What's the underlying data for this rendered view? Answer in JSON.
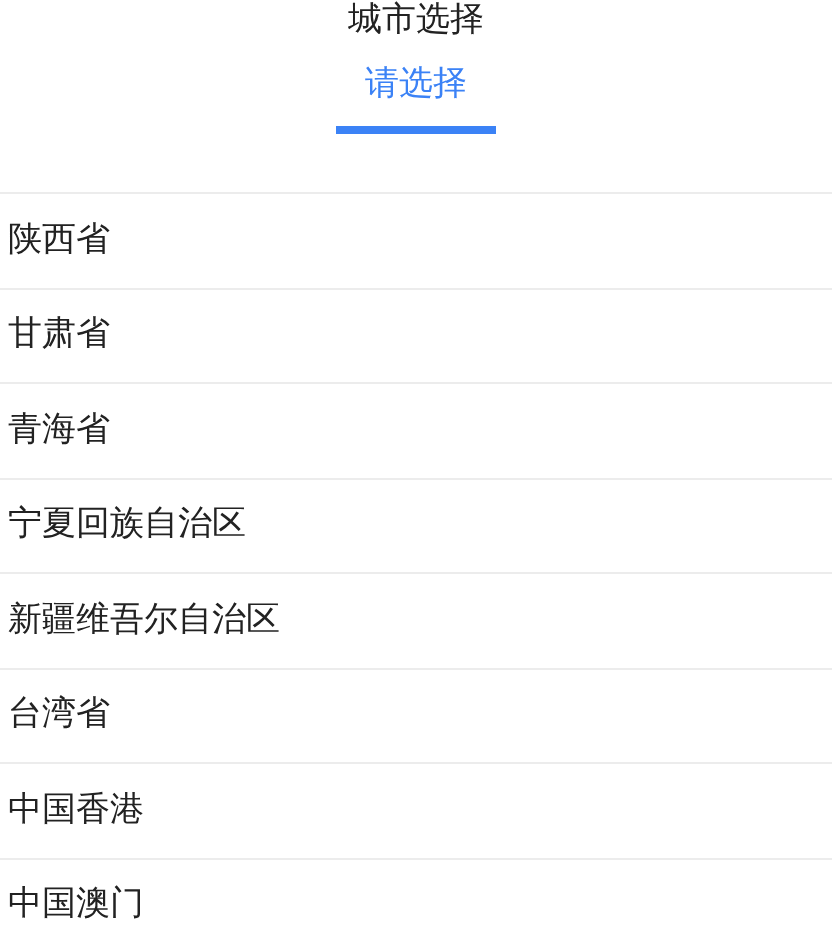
{
  "title": "城市选择",
  "tabs": [
    {
      "label": "请选择",
      "selected": true
    }
  ],
  "provinces": [
    {
      "name": "陕西省"
    },
    {
      "name": "甘肃省"
    },
    {
      "name": "青海省"
    },
    {
      "name": "宁夏回族自治区"
    },
    {
      "name": "新疆维吾尔自治区"
    },
    {
      "name": "台湾省"
    },
    {
      "name": "中国香港"
    },
    {
      "name": "中国澳门"
    }
  ]
}
